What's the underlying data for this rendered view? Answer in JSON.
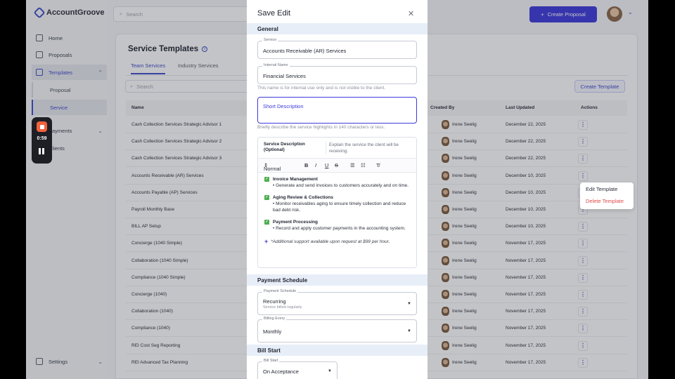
{
  "app": {
    "brand": "AccountGroove",
    "search_placeholder": "Search",
    "create_proposal": "Create Proposal"
  },
  "sidebar": {
    "home": "Home",
    "proposals": "Proposals",
    "templates": "Templates",
    "sub_proposal": "Proposal",
    "sub_service": "Service",
    "payments": "Payments",
    "clients": "Clients",
    "settings": "Settings"
  },
  "page": {
    "title": "Service Templates",
    "tab_team": "Team Services",
    "tab_industry": "Industry Services",
    "search_placeholder": "Search",
    "create_template": "Create Template"
  },
  "table": {
    "headers": {
      "name": "Name",
      "created_by": "Created By",
      "last_updated": "Last Updated",
      "actions": "Actions"
    },
    "rows": [
      {
        "name": "Cash Collection Services Strategic Advisor 1",
        "by": "Irene Seelig",
        "date": "December 22, 2025"
      },
      {
        "name": "Cash Collection Services Strategic Advisor 2",
        "by": "Irene Seelig",
        "date": "December 22, 2025"
      },
      {
        "name": "Cash Collection Services Strategic Advisor 3",
        "by": "Irene Seelig",
        "date": "December 22, 2025"
      },
      {
        "name": "Accounts Receivable (AR) Services",
        "by": "Irene Seelig",
        "date": "December 10, 2025"
      },
      {
        "name": "Accounts Payable (AP) Services",
        "by": "Irene Seelig",
        "date": "December 10, 2025"
      },
      {
        "name": "Payroll Monthly Base",
        "by": "Irene Seelig",
        "date": "December 10, 2025"
      },
      {
        "name": "BILL AP Setup",
        "by": "Irene Seelig",
        "date": "December 10, 2025"
      },
      {
        "name": "Concierge (1040 Simple)",
        "by": "Irene Seelig",
        "date": "November 17, 2025"
      },
      {
        "name": "Collaboration (1040 Simple)",
        "by": "Irene Seelig",
        "date": "November 17, 2025"
      },
      {
        "name": "Compliance (1040 Simple)",
        "by": "Irene Seelig",
        "date": "November 17, 2025"
      },
      {
        "name": "Concierge (1040)",
        "by": "Irene Seelig",
        "date": "November 17, 2025"
      },
      {
        "name": "Collaboration (1040)",
        "by": "Irene Seelig",
        "date": "November 17, 2025"
      },
      {
        "name": "Compliance (1040)",
        "by": "Irene Seelig",
        "date": "November 17, 2025"
      },
      {
        "name": "REI Cost Seg Reporting",
        "by": "Irene Seelig",
        "date": "November 17, 2025"
      },
      {
        "name": "REI Advanced Tax Planning",
        "by": "Irene Seelig",
        "date": "November 17, 2025"
      }
    ]
  },
  "context_menu": {
    "edit": "Edit Template",
    "delete": "Delete Template"
  },
  "recorder": {
    "time": "0:59"
  },
  "modal": {
    "title": "Save Edit",
    "general": "General",
    "service_label": "Service",
    "service_value": "Accounts Receivable (AR) Services",
    "internal_label": "Internal Name",
    "internal_value": "Financial Services",
    "internal_helper": "This name is for internal use only and is not visible to the client.",
    "short_desc_placeholder": "Short Description",
    "short_desc_helper": "Briefly describe the service highlights in 140 characters or less.",
    "sd_label": "Service Description (Optional)",
    "sd_hint": "Explain the service the client will be receiving.",
    "format_select": "Normal",
    "blocks": [
      {
        "title": "Invoice Management",
        "desc": "Generate and send invoices to customers accurately and on time."
      },
      {
        "title": "Aging Review & Collections",
        "desc": "Monitor receivables aging to ensure timely collection and reduce bad debt risk."
      },
      {
        "title": "Payment Processing",
        "desc": "Record and apply customer payments in the accounting system."
      }
    ],
    "note": "*Additional support available upon request at $99 per hour.",
    "payment_schedule": "Payment Schedule",
    "ps_label": "Payment Schedule",
    "ps_value": "Recurring",
    "ps_sub": "Service billed regularly",
    "billing_label": "Billing Every",
    "billing_value": "Monthly",
    "bill_start": "Bill Start",
    "bs_label": "Bill Start",
    "bs_value": "On Acceptance"
  }
}
